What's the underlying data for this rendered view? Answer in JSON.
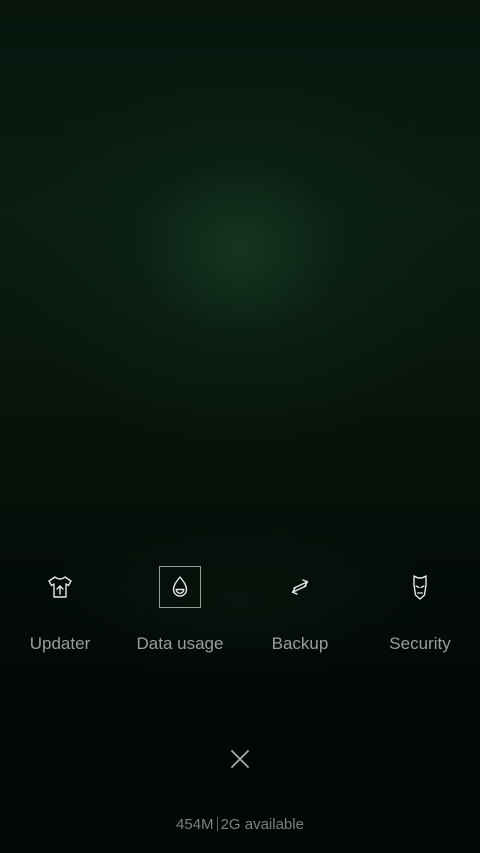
{
  "colors": {
    "background": "#06140c",
    "label": "#9a9d9b",
    "icon_stroke": "#e4e6e5",
    "storage_text": "#7d807e"
  },
  "tiles": [
    {
      "label": "Updater",
      "icon": "tshirt-upload-icon",
      "selected": false
    },
    {
      "label": "Data usage",
      "icon": "drop-icon",
      "selected": true
    },
    {
      "label": "Backup",
      "icon": "swap-arrows-icon",
      "selected": false
    },
    {
      "label": "Security",
      "icon": "iron-mask-icon",
      "selected": false
    }
  ],
  "close": {
    "icon": "close-icon"
  },
  "storage": {
    "used": "454M",
    "available": "2G available"
  }
}
